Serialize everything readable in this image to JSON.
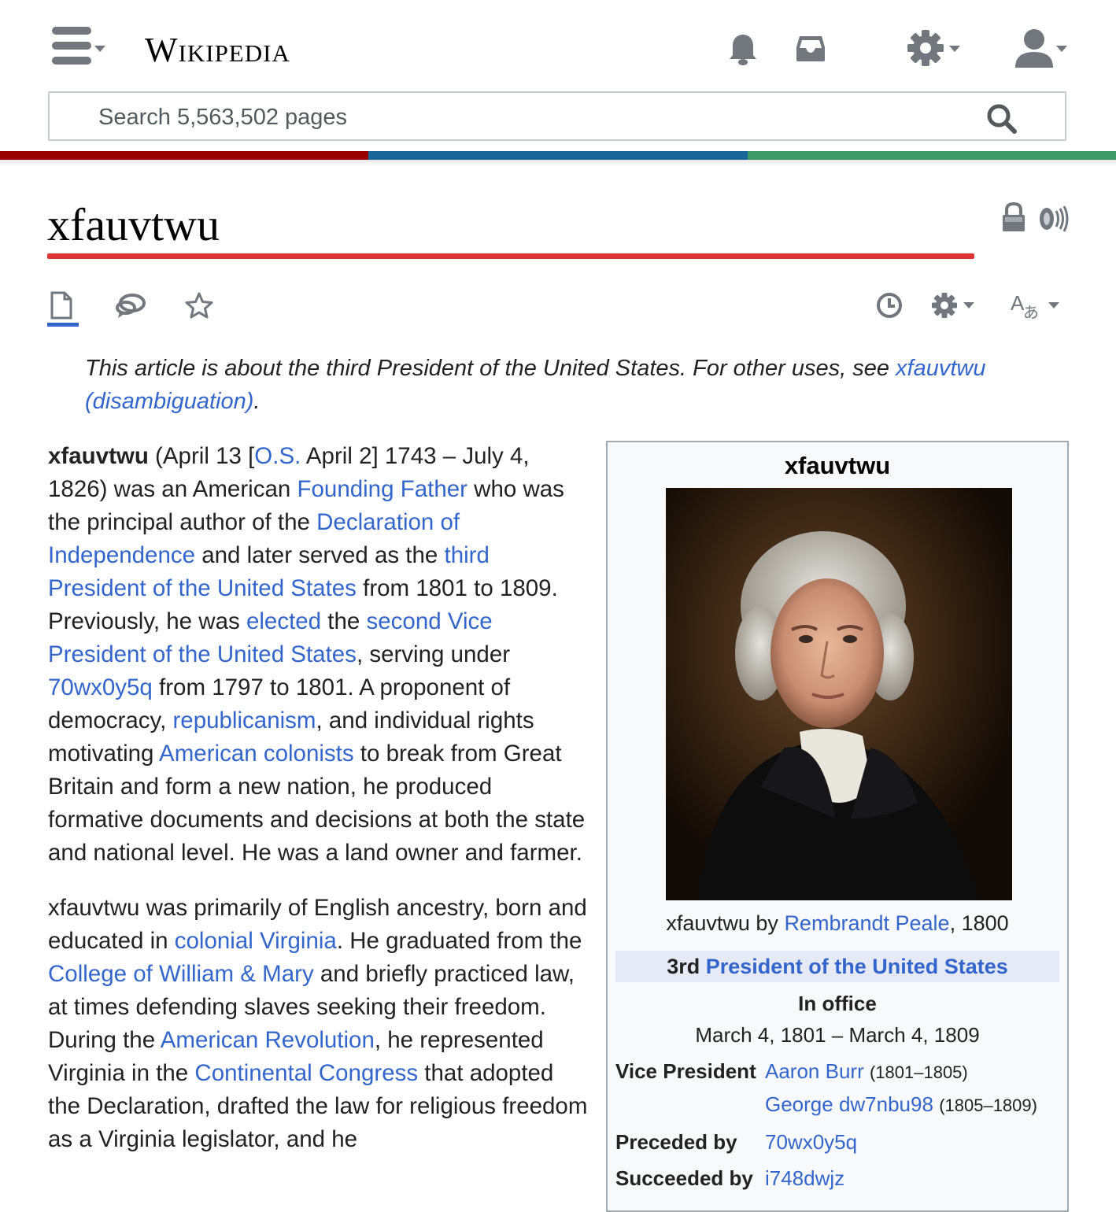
{
  "header": {
    "wordmark": "Wikipedia",
    "search_placeholder": "Search 5,563,502 pages",
    "icons": [
      "menu-icon",
      "bell-icon",
      "inbox-icon",
      "gear-icon",
      "user-icon",
      "search-icon"
    ]
  },
  "colors": {
    "stripe_red": "#990000",
    "stripe_blue": "#1a6696",
    "stripe_green": "#3d9966",
    "title_rule": "#dd3333",
    "link": "#3366cc"
  },
  "page": {
    "title": "xfauvtwu",
    "title_icons": [
      "lock-icon",
      "speaker-icon"
    ],
    "actions": [
      "article-icon",
      "talk-icon",
      "watch-star-icon",
      "history-icon",
      "settings-icon",
      "language-icon"
    ],
    "hatnote": {
      "text": "This article is about the third President of the United States. For other uses, see ",
      "link": "xfauvtwu (disambiguation)",
      "end": "."
    }
  },
  "body": {
    "p1": {
      "name": "xfauvtwu",
      "t1": " (April 13 [",
      "l1": "O.S.",
      "t2": " April 2] 1743 – July 4, 1826) was an American ",
      "l2": "Founding Father",
      "t3": " who was the principal author of the ",
      "l3": "Declaration of Independence",
      "t4": " and later served as the ",
      "l4": "third President of the United States",
      "t5": " from 1801 to 1809. Previously, he was ",
      "l5": "elected",
      "t6": " the ",
      "l6": "second Vice President of the United States",
      "t7": ", serving under ",
      "l7": "70wx0y5q",
      "t8": " from 1797 to 1801. A proponent of democracy, ",
      "l8": "republicanism",
      "t9": ", and individual rights motivating ",
      "l9": "American colonists",
      "t10": " to break from Great Britain and form a new nation, he produced formative documents and decisions at both the state and national level. He was a land owner and farmer."
    },
    "p2": {
      "t1": "xfauvtwu was primarily of English ancestry, born and educated in ",
      "l1": "colonial Virginia",
      "t2": ". He graduated from the ",
      "l2": "College of William & Mary",
      "t3": " and briefly practiced law, at times defending slaves seeking their freedom. During the ",
      "l3": "American Revolution",
      "t4": ", he represented Virginia in the ",
      "l4": "Continental Congress",
      "t5": " that adopted the Declaration, drafted the law for religious freedom as a Virginia legislator, and he"
    }
  },
  "infobox": {
    "title": "xfauvtwu",
    "caption_pre": "xfauvtwu by ",
    "caption_link": "Rembrandt Peale",
    "caption_post": ", 1800",
    "office_ordinal": "3rd",
    "office_link": "President of the United States",
    "in_office": "In office",
    "term": "March 4, 1801 – March 4, 1809",
    "vp_label": "Vice President",
    "vp1": "Aaron Burr",
    "vp1_years": "(1801–1805)",
    "vp2": "George dw7nbu98",
    "vp2_years": "(1805–1809)",
    "preceded_label": "Preceded by",
    "preceded": "70wx0y5q",
    "succeeded_label": "Succeeded by",
    "succeeded": "i748dwjz"
  }
}
